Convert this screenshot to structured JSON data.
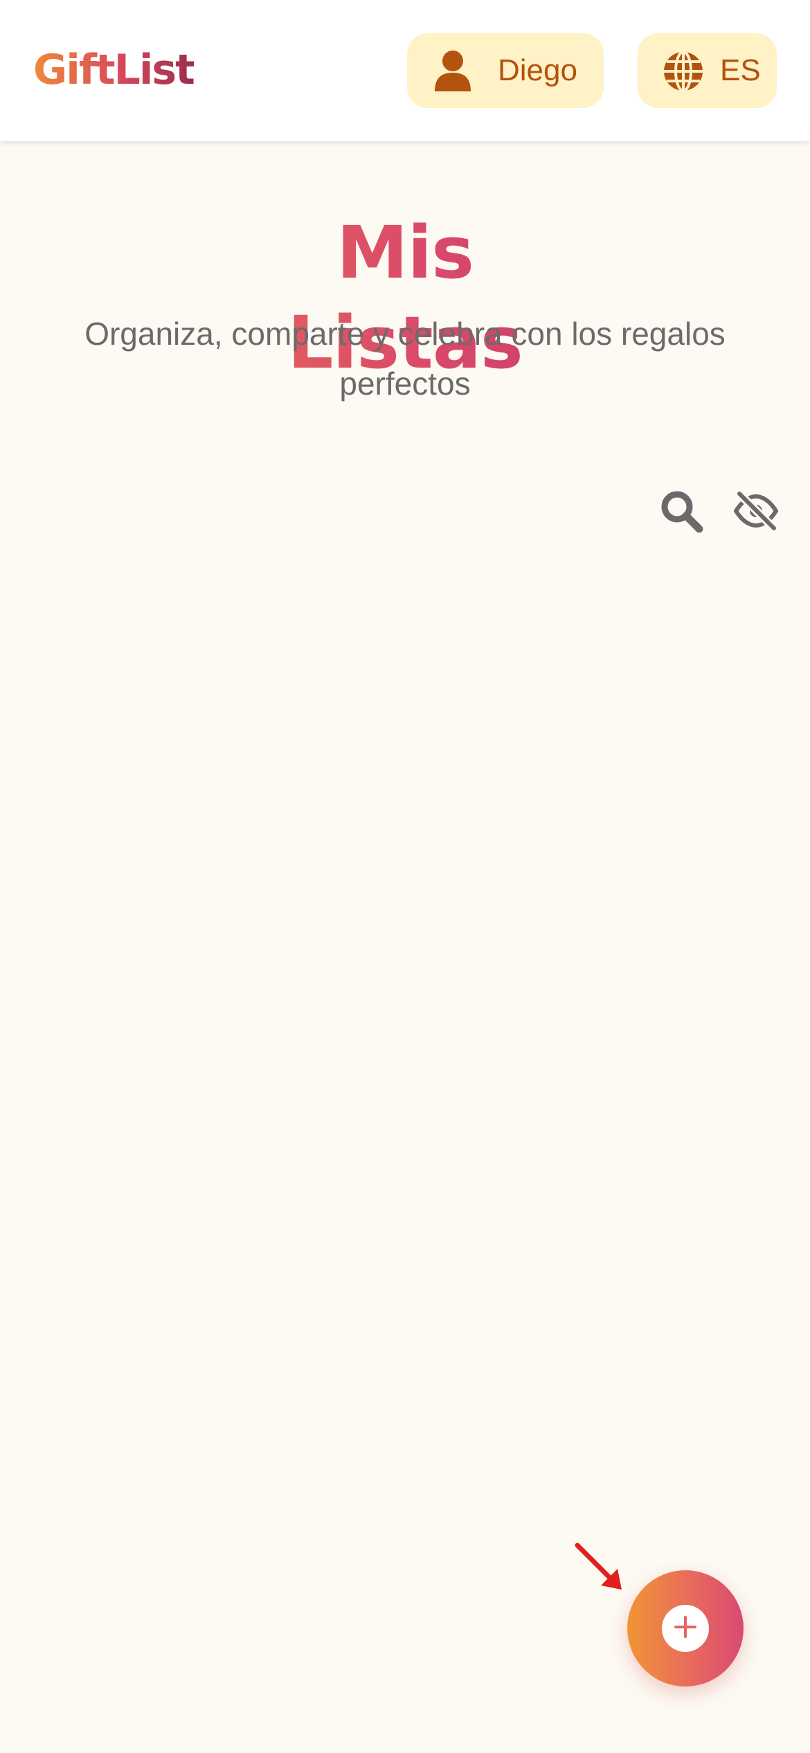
{
  "header": {
    "logo": "GiftList",
    "user_name": "Diego",
    "user_icon": "user-icon",
    "language": "ES",
    "language_icon": "globe-icon"
  },
  "hero": {
    "title": "Mis Listas",
    "subtitle": "Organiza, comparte y celebra con los regalos perfectos"
  },
  "tools": {
    "search_icon": "search-icon",
    "hide_icon": "eye-slash-icon"
  },
  "fab": {
    "icon": "plus-icon"
  },
  "colors": {
    "background": "#fdf9f3",
    "pill_background": "#fef2c6",
    "pill_text": "#b4520f",
    "brand_orange": "#ee8a3b",
    "brand_pink": "#d9485a",
    "annotation_arrow": "#e02020"
  }
}
